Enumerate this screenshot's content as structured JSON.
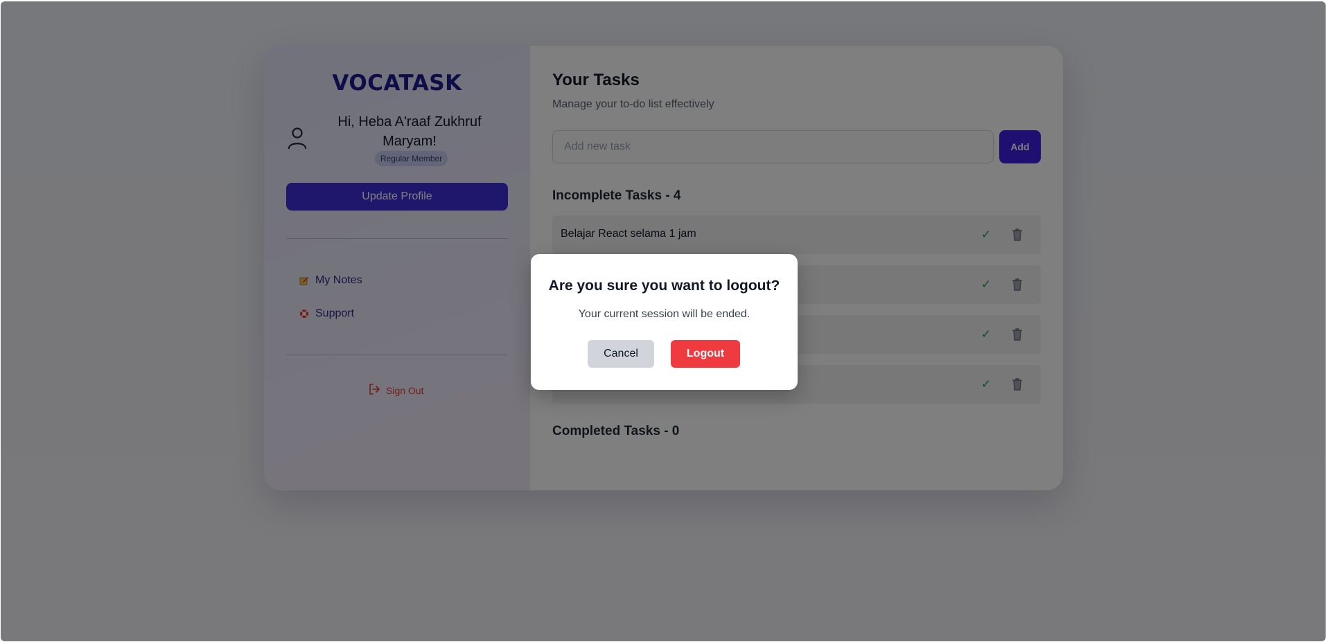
{
  "brand": {
    "name": "VOCATASK"
  },
  "profile": {
    "greeting": "Hi, Heba A'raaf Zukhruf Maryam!",
    "role_badge": "Regular Member",
    "update_button": "Update Profile"
  },
  "nav": {
    "items": [
      {
        "label": "My Notes",
        "icon": "notes-icon"
      },
      {
        "label": "Support",
        "icon": "lifebuoy-icon"
      }
    ],
    "signout_label": "Sign Out"
  },
  "main": {
    "title": "Your Tasks",
    "subtitle": "Manage your to-do list effectively",
    "input_placeholder": "Add new task",
    "input_value": "",
    "add_button": "Add",
    "incomplete_title": "Incomplete Tasks - 4",
    "completed_title": "Completed Tasks - 0",
    "incomplete_tasks": [
      {
        "text": "Belajar React selama 1 jam",
        "check": "✓"
      },
      {
        "text": "",
        "check": "✓"
      },
      {
        "text": "",
        "check": "✓"
      },
      {
        "text": "",
        "check": "✓"
      }
    ]
  },
  "modal": {
    "title": "Are you sure you want to logout?",
    "message": "Your current session will be ended.",
    "cancel_label": "Cancel",
    "logout_label": "Logout"
  },
  "colors": {
    "brand": "#1e1b8f",
    "primary_button": "#3f2fd8",
    "add_button": "#3d1fe0",
    "danger": "#ef3b3f",
    "check": "#16a34a",
    "signout": "#e53935"
  }
}
